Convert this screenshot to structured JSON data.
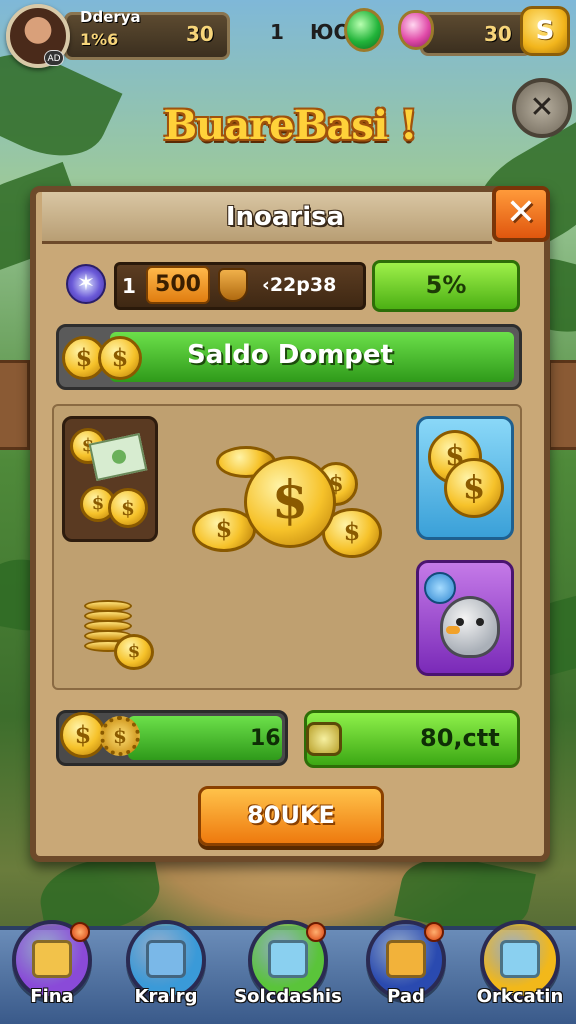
{
  "player": {
    "name": "Dderya",
    "level": "1%6",
    "score": "30",
    "avatar_badge": "AD"
  },
  "top_stats": {
    "stat_a": "1",
    "stat_b": "ЮО"
  },
  "currency": {
    "value": "30",
    "coin_symbol": "S"
  },
  "game_title": "BuareBasi !",
  "panel": {
    "title": "Inoarisa",
    "close_symbol": "✕",
    "resource": {
      "prefix": "1",
      "chip": "500",
      "value": "‹22p38"
    },
    "percent_button": "5%",
    "wallet_label": "Saldo Dompet"
  },
  "bars": {
    "left_value": "16",
    "right_value": "80,ctt"
  },
  "action_button": "80UKE",
  "bottom_nav": [
    {
      "label": "Fina",
      "color": "#8a4ad8",
      "glyph": "#f2c24a"
    },
    {
      "label": "Kralrg",
      "color": "#3a9ad8",
      "glyph": "#7ab8e8"
    },
    {
      "label": "Solcdashis",
      "color": "#5ac43a",
      "glyph": "#8ad0f0"
    },
    {
      "label": "Pad",
      "color": "#2a4ab0",
      "glyph": "#f2b23a"
    },
    {
      "label": "Orkcatin",
      "color": "#f2b81a",
      "glyph": "#8ad0f0"
    }
  ]
}
